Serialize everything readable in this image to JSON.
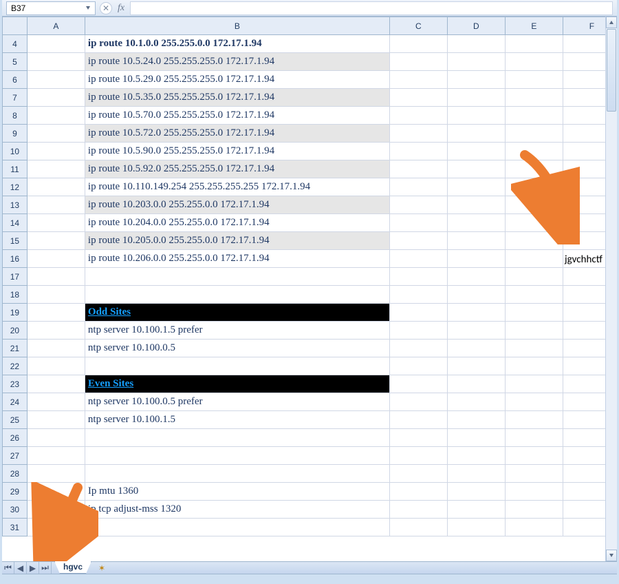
{
  "formula_bar": {
    "name_box": "B37",
    "fx_label": "fx",
    "formula": ""
  },
  "columns": [
    "A",
    "B",
    "C",
    "D",
    "E",
    "F"
  ],
  "row_start": 4,
  "row_end": 31,
  "table1": {
    "header": "ip route 10.1.0.0 255.255.0.0 172.17.1.94",
    "rows": [
      "ip route 10.5.24.0 255.255.255.0 172.17.1.94",
      "ip route 10.5.29.0 255.255.255.0 172.17.1.94",
      "ip route 10.5.35.0 255.255.255.0 172.17.1.94",
      "ip route 10.5.70.0 255.255.255.0 172.17.1.94",
      "ip route 10.5.72.0 255.255.255.0 172.17.1.94",
      "ip route 10.5.90.0 255.255.255.0 172.17.1.94",
      "ip route 10.5.92.0 255.255.255.0 172.17.1.94",
      "ip route 10.110.149.254 255.255.255.255 172.17.1.94",
      "ip route 10.203.0.0 255.255.0.0 172.17.1.94",
      "ip route 10.204.0.0 255.255.0.0 172.17.1.94",
      "ip route 10.205.0.0 255.255.0.0 172.17.1.94",
      "ip route 10.206.0.0 255.255.0.0 172.17.1.94"
    ]
  },
  "odd_sites": {
    "header": "Odd Sites",
    "rows": [
      "ntp server 10.100.1.5 prefer",
      "ntp server 10.100.0.5"
    ]
  },
  "even_sites": {
    "header": "Even Sites",
    "rows": [
      "ntp server 10.100.0.5 prefer",
      "ntp server 10.100.1.5"
    ]
  },
  "mtu_block": {
    "rows": [
      "Ip mtu 1360",
      "ip tcp adjust-mss 1320"
    ]
  },
  "annotation_right": "jgvchhctf",
  "sheet_tab": "hgvc",
  "icons": {
    "nav_first": "⏮",
    "nav_prev": "◀",
    "nav_next": "▶",
    "nav_last": "⏭",
    "new_tab": "✶"
  }
}
